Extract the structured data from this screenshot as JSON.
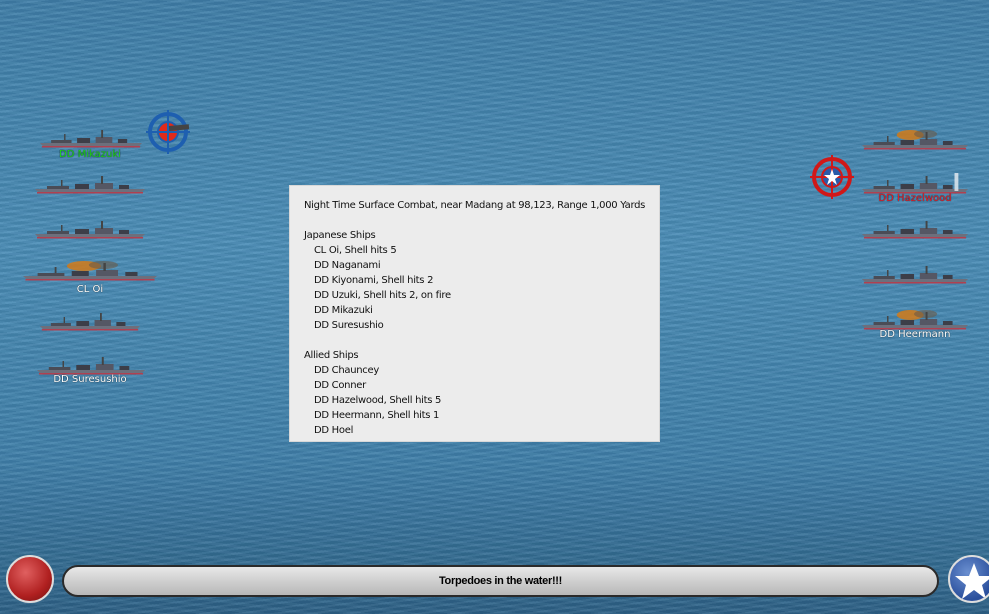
{
  "japanese_ships": [
    {
      "label": "DD Mikazuki",
      "label_color": "#1fd11f",
      "fire": false
    },
    {
      "label": "",
      "fire": false
    },
    {
      "label": "",
      "fire": false
    },
    {
      "label": "CL Oi",
      "label_color": "#ffffff",
      "fire": true
    },
    {
      "label": "",
      "fire": false
    },
    {
      "label": "DD Suresushio",
      "label_color": "#ffffff",
      "fire": false
    }
  ],
  "allied_ships": [
    {
      "label": "",
      "fire": true
    },
    {
      "label": "DD Hazelwood",
      "label_color": "#e0202a",
      "fire": false,
      "splash": true
    },
    {
      "label": "",
      "fire": false
    },
    {
      "label": "",
      "fire": false
    },
    {
      "label": "DD Heermann",
      "label_color": "#ffffff",
      "fire": true
    }
  ],
  "targets": {
    "japanese": "crosshair-blue-icon",
    "allied": "crosshair-red-star-icon"
  },
  "report": {
    "title": "Night Time Surface Combat, near Madang at 98,123, Range 1,000 Yards",
    "japanese_header": "Japanese Ships",
    "japanese": [
      "CL Oi, Shell hits 5",
      "DD Naganami",
      "DD Kiyonami, Shell hits 2",
      "DD Uzuki, Shell hits 2,  on fire",
      "DD Mikazuki",
      "DD Suresushio"
    ],
    "allied_header": "Allied Ships",
    "allied": [
      "DD Chauncey",
      "DD Conner",
      "DD Hazelwood, Shell hits 5",
      "DD Heermann, Shell hits 1",
      "DD Hoel"
    ]
  },
  "status": {
    "message": "Torpedoes in the water!!!"
  },
  "colors": {
    "japanese": "#c0392b",
    "allied": "#2a4f9c"
  }
}
